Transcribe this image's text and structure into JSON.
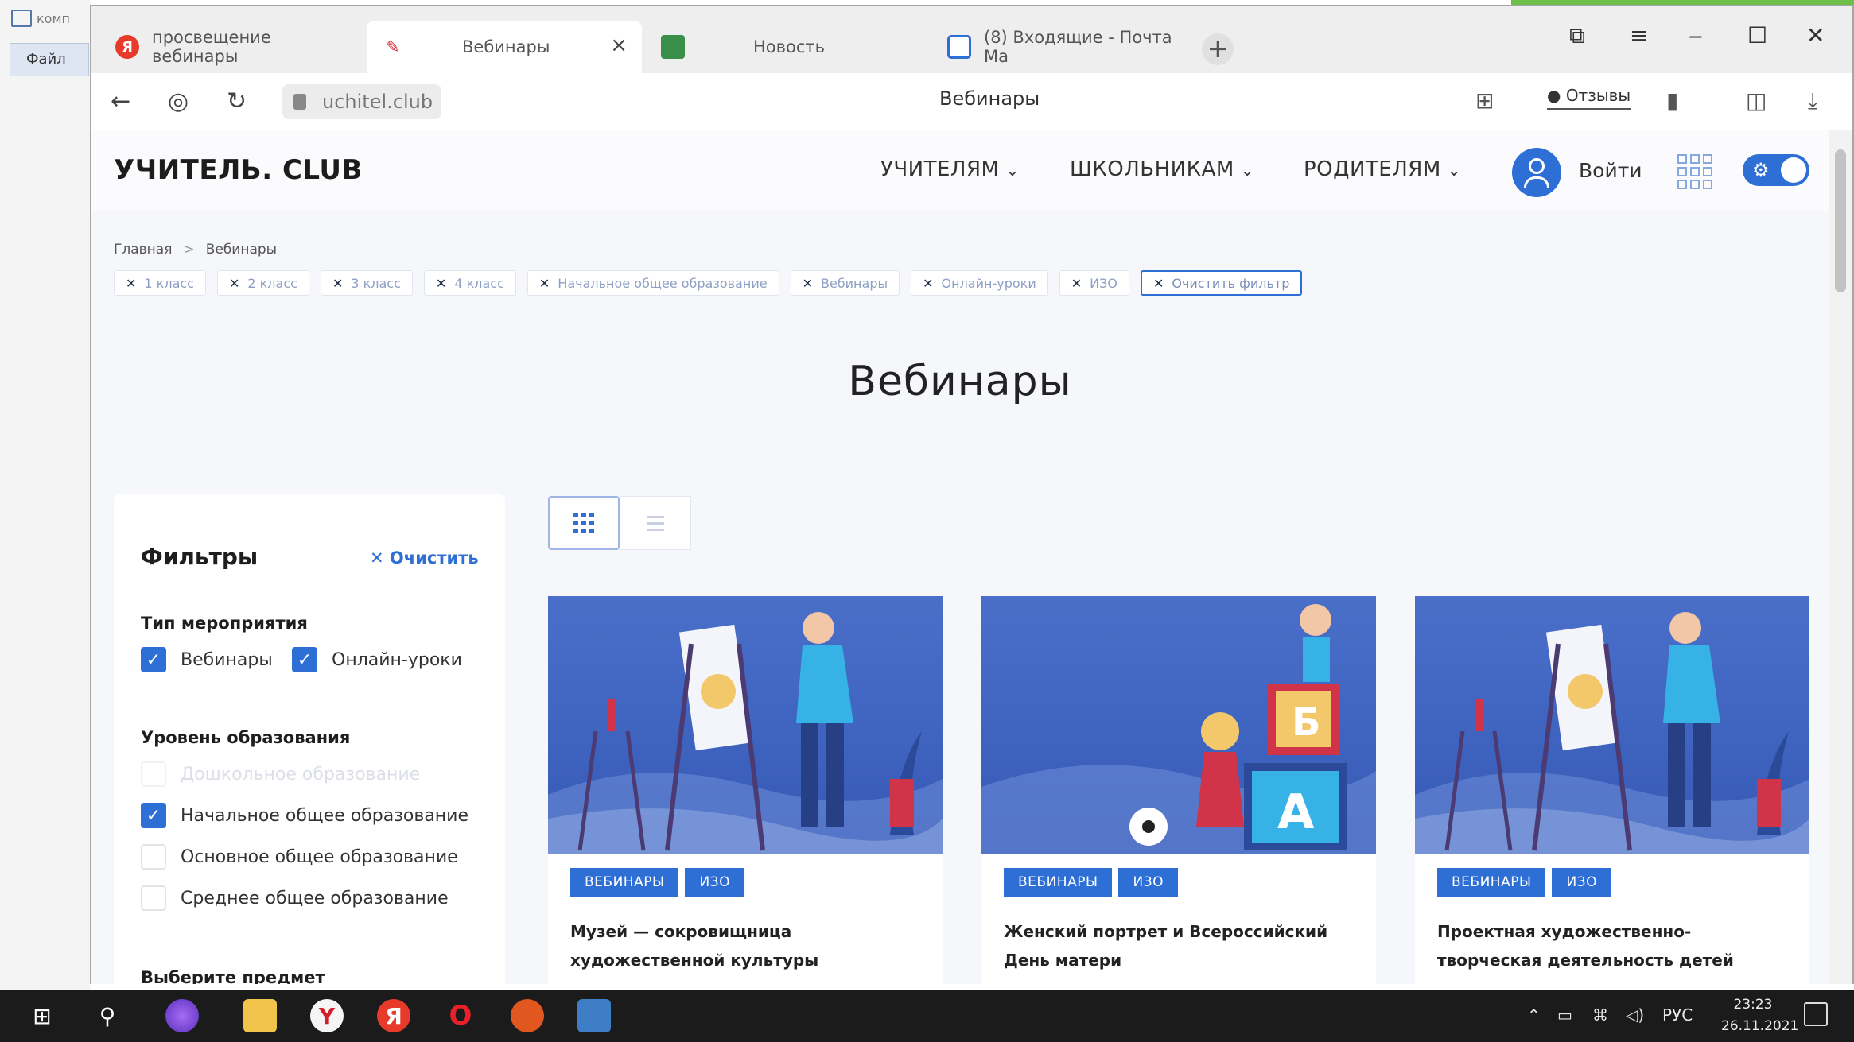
{
  "desktop": {
    "left_app_title": "комп",
    "left_menu_file": "Файл"
  },
  "browser": {
    "tabs": [
      {
        "label": "просвещение вебинары",
        "favicon": "yandex-icon",
        "active": false
      },
      {
        "label": "Вебинары",
        "favicon": "uchitel-icon",
        "active": true
      },
      {
        "label": "Новость",
        "favicon": "site-icon",
        "active": false
      },
      {
        "label": "(8) Входящие - Почта Ма",
        "favicon": "mail-icon",
        "active": false
      }
    ],
    "new_tab": "+",
    "url": "uchitel.club",
    "page_title": "Вебинары",
    "reviews_label": "Отзывы"
  },
  "site": {
    "logo": "УЧИТЕЛЬ. CLUB",
    "nav": [
      "УЧИТЕЛЯМ",
      "ШКОЛЬНИКАМ",
      "РОДИТЕЛЯМ"
    ],
    "login": "Войти",
    "breadcrumbs": [
      "Главная",
      "Вебинары"
    ],
    "chips": [
      "1 класс",
      "2 класс",
      "3 класс",
      "4 класс",
      "Начальное общее образование",
      "Вебинары",
      "Онлайн-уроки",
      "ИЗО"
    ],
    "clear_filter_chip": "Очистить фильтр",
    "heading": "Вебинары",
    "filters": {
      "title": "Фильтры",
      "clear": "Очистить",
      "event_type_title": "Тип мероприятия",
      "event_types": [
        {
          "label": "Вебинары",
          "checked": true
        },
        {
          "label": "Онлайн-уроки",
          "checked": true
        }
      ],
      "edu_level_title": "Уровень образования",
      "edu_levels": [
        {
          "label": "Дошкольное образование",
          "checked": false,
          "disabled": true
        },
        {
          "label": "Начальное общее образование",
          "checked": true,
          "disabled": false
        },
        {
          "label": "Основное общее образование",
          "checked": false,
          "disabled": false
        },
        {
          "label": "Среднее общее образование",
          "checked": false,
          "disabled": false
        }
      ],
      "subject_title": "Выберите предмет"
    },
    "cards": [
      {
        "tags": [
          "ВЕБИНАРЫ",
          "ИЗО"
        ],
        "title": "Музей — сокровищница художественной культуры",
        "image": "painter-illustration"
      },
      {
        "tags": [
          "ВЕБИНАРЫ",
          "ИЗО"
        ],
        "title": "Женский портрет и Всероссийский День матери",
        "image": "blocks-illustration"
      },
      {
        "tags": [
          "ВЕБИНАРЫ",
          "ИЗО"
        ],
        "title": "Проектная художественно-творческая деятельность детей младшего школьного возраста: выставочный проект «Я вижу",
        "image": "painter-illustration"
      }
    ]
  },
  "taskbar": {
    "lang": "РУС",
    "time": "23:23",
    "date": "26.11.2021"
  },
  "colors": {
    "accent": "#2e6fd6",
    "card_bg": "#4a6fc9",
    "taskbar": "#1b1b1b"
  }
}
